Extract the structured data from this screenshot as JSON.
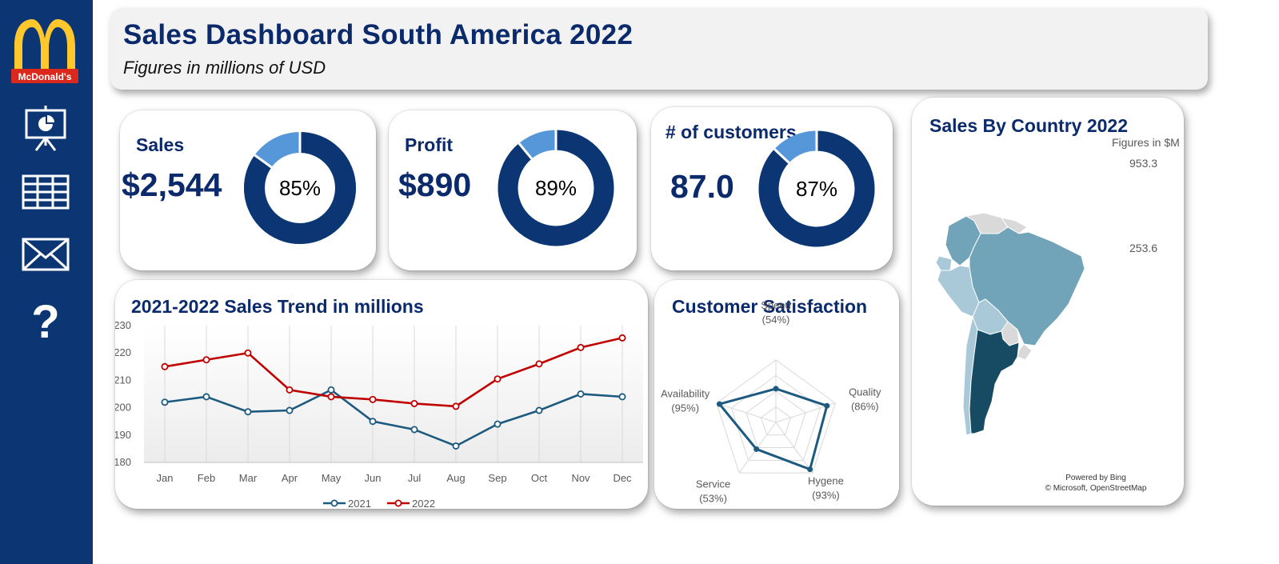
{
  "header": {
    "title": "Sales Dashboard South America 2022",
    "subtitle": "Figures in millions of USD"
  },
  "sidebar": {
    "logo_text": "McDonald's",
    "items": [
      {
        "name": "presentation-icon"
      },
      {
        "name": "table-icon"
      },
      {
        "name": "mail-icon"
      },
      {
        "name": "help-icon",
        "glyph": "?"
      }
    ]
  },
  "colors": {
    "navy": "#0b3673",
    "donut_primary": "#0b3673",
    "donut_secondary": "#5597d8",
    "series_2021": "#1d5a80",
    "series_2022": "#c00000",
    "map_dark": "#164b63",
    "map_mid": "#72a4b9",
    "map_light": "#a9c9d8"
  },
  "kpis": [
    {
      "label": "Sales",
      "value": "$2,544",
      "percent": "85%",
      "fraction": 0.85
    },
    {
      "label": "Profit",
      "value": "$890",
      "percent": "89%",
      "fraction": 0.89
    },
    {
      "label": "# of customers",
      "value": "87.0",
      "percent": "87%",
      "fraction": 0.87
    }
  ],
  "trend": {
    "title": "2021-2022 Sales Trend in millions"
  },
  "satisfaction": {
    "title": "Customer Satisfaction"
  },
  "map": {
    "title": "Sales By Country 2022",
    "unit_note": "Figures in $M",
    "legend_max": "953.3",
    "legend_min": "253.6",
    "powered_by": "Powered by Bing",
    "copyright": "© Microsoft, OpenStreetMap"
  },
  "chart_data": [
    {
      "type": "line",
      "title": "2021-2022 Sales Trend in millions",
      "categories": [
        "Jan",
        "Feb",
        "Mar",
        "Apr",
        "May",
        "Jun",
        "Jul",
        "Aug",
        "Sep",
        "Oct",
        "Nov",
        "Dec"
      ],
      "series": [
        {
          "name": "2021",
          "values": [
            202,
            204,
            198.5,
            199,
            206.5,
            195,
            192,
            186,
            194,
            199,
            205,
            204
          ]
        },
        {
          "name": "2022",
          "values": [
            215,
            217.5,
            220,
            206.5,
            204,
            203,
            201.5,
            200.5,
            210.5,
            216,
            222,
            225.5
          ]
        }
      ],
      "ylim": [
        180,
        230
      ],
      "yticks": [
        "180",
        "190",
        "200",
        "210",
        "220",
        "230"
      ],
      "legend": "bottom"
    },
    {
      "type": "radar",
      "title": "Customer Satisfaction",
      "axes": [
        {
          "label": "Speed",
          "pct_label": "(54%)",
          "value": 54
        },
        {
          "label": "Quality",
          "pct_label": "(86%)",
          "value": 86
        },
        {
          "label": "Hygene",
          "pct_label": "(93%)",
          "value": 93
        },
        {
          "label": "Service",
          "pct_label": "(53%)",
          "value": 53
        },
        {
          "label": "Availability",
          "pct_label": "(95%)",
          "value": 95
        }
      ],
      "max": 100
    }
  ]
}
